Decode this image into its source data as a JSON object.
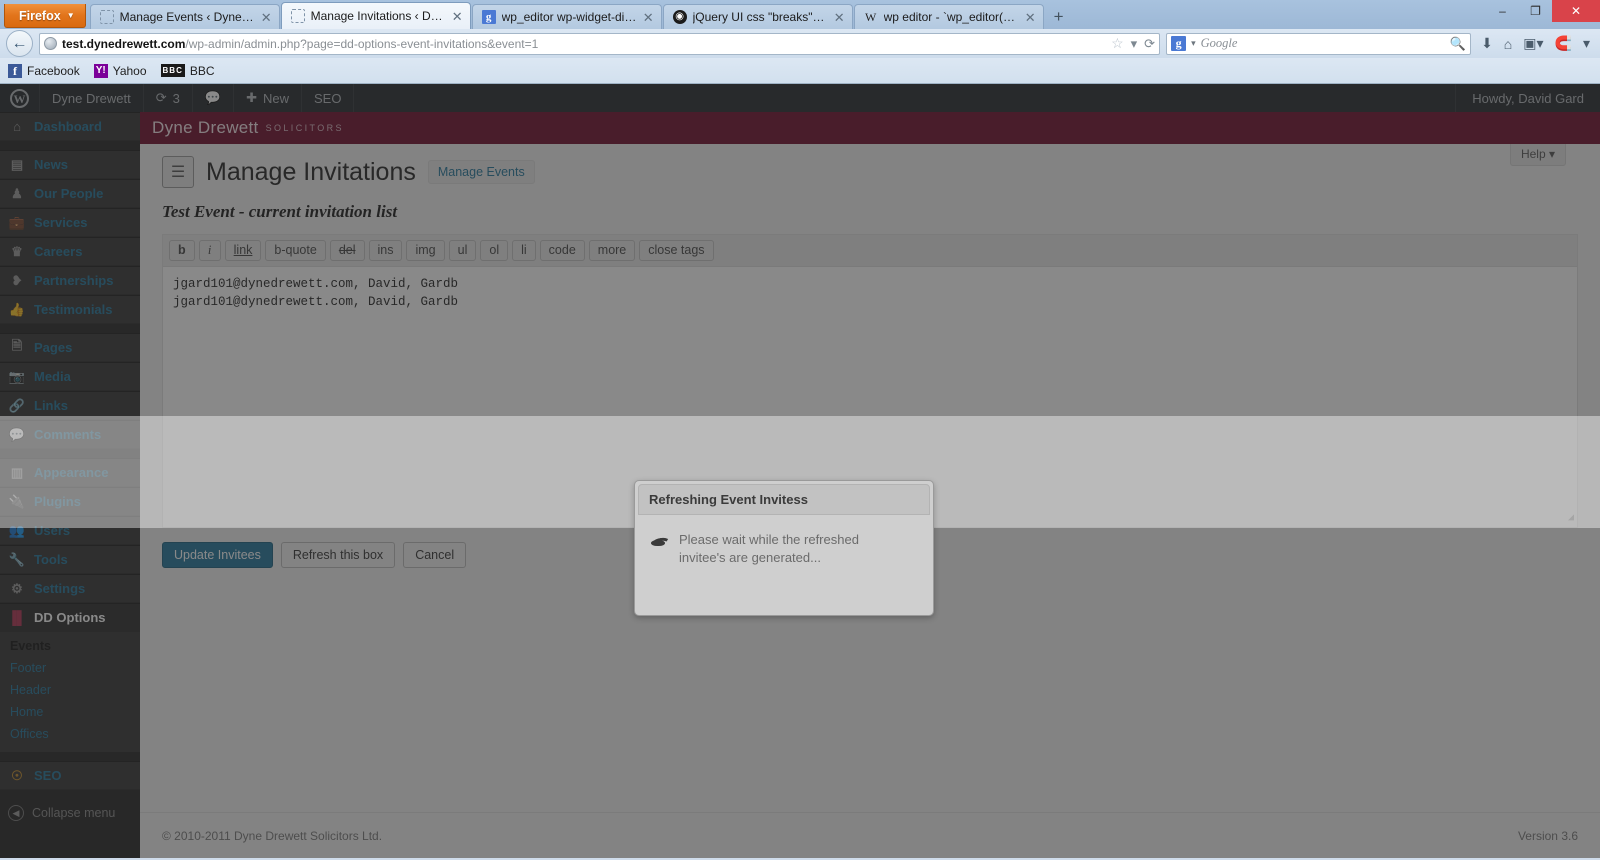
{
  "browser": {
    "app_button": "Firefox",
    "tabs": [
      {
        "title": "Manage Events ‹ Dyne Drewett — Wo...",
        "icon": "blank-favicon",
        "active": false
      },
      {
        "title": "Manage Invitations ‹ Dyne Drewett —...",
        "icon": "blank-favicon",
        "active": true
      },
      {
        "title": "wp_editor wp-widget-dialog - Googl...",
        "icon": "google-favicon",
        "active": false
      },
      {
        "title": "jQuery UI css \"breaks\" WP Editor · Iss...",
        "icon": "github-favicon",
        "active": false
      },
      {
        "title": "wp editor - `wp_editor()` CSS messing...",
        "icon": "wordpress-stack-favicon",
        "active": false
      }
    ],
    "new_tab_label": "+",
    "window_controls": {
      "minimize": "–",
      "restore": "❐",
      "close": "✕"
    },
    "url": {
      "host": "test.dynedrewett.com",
      "path": "/wp-admin/admin.php?page=dd-options-event-invitations&event=1",
      "prefix": ""
    },
    "search": {
      "engine": "Google",
      "placeholder": "Google"
    },
    "bookmarks": [
      {
        "label": "Facebook",
        "icon": "facebook-icon"
      },
      {
        "label": "Yahoo",
        "icon": "yahoo-icon"
      },
      {
        "label": "BBC",
        "icon": "bbc-icon"
      }
    ]
  },
  "adminbar": {
    "logo": "wordpress-logo",
    "site_name": "Dyne Drewett",
    "updates_count": "3",
    "comments_icon": "comment-icon",
    "new_label": "New",
    "seo_label": "SEO",
    "howdy": "Howdy, David Gard"
  },
  "sidebar": {
    "items": [
      {
        "label": "Dashboard",
        "icon": "dashboard-icon"
      },
      {
        "label": "News",
        "icon": "news-icon"
      },
      {
        "label": "Our People",
        "icon": "people-icon"
      },
      {
        "label": "Services",
        "icon": "services-icon"
      },
      {
        "label": "Careers",
        "icon": "careers-icon"
      },
      {
        "label": "Partnerships",
        "icon": "partnerships-icon"
      },
      {
        "label": "Testimonials",
        "icon": "testimonials-icon"
      },
      {
        "label": "Pages",
        "icon": "pages-icon"
      },
      {
        "label": "Media",
        "icon": "media-icon"
      },
      {
        "label": "Links",
        "icon": "links-icon"
      },
      {
        "label": "Comments",
        "icon": "comments-icon"
      },
      {
        "label": "Appearance",
        "icon": "appearance-icon"
      },
      {
        "label": "Plugins",
        "icon": "plugins-icon"
      },
      {
        "label": "Users",
        "icon": "users-icon"
      },
      {
        "label": "Tools",
        "icon": "tools-icon"
      },
      {
        "label": "Settings",
        "icon": "settings-icon"
      },
      {
        "label": "DD Options",
        "icon": "dd-options-icon"
      }
    ],
    "submenu": [
      {
        "label": "Events",
        "current": true
      },
      {
        "label": "Footer",
        "current": false
      },
      {
        "label": "Header",
        "current": false
      },
      {
        "label": "Home",
        "current": false
      },
      {
        "label": "Offices",
        "current": false
      }
    ],
    "seo_item": {
      "label": "SEO",
      "icon": "seo-icon"
    },
    "collapse_label": "Collapse menu"
  },
  "brand": {
    "name": "Dyne Drewett",
    "tagline": "SOLICITORS",
    "color": "#6e0b2b"
  },
  "page": {
    "help_tab": "Help",
    "title": "Manage Invitations",
    "title_icon": "options-sliders-icon",
    "secondary_button": "Manage Events",
    "subheading": "Test Event - current invitation list"
  },
  "editor": {
    "quicktags": [
      "b",
      "i",
      "link",
      "b-quote",
      "del",
      "ins",
      "img",
      "ul",
      "ol",
      "li",
      "code",
      "more",
      "close tags"
    ],
    "content_lines": [
      "jgard101@dynedrewett.com, David, Gardb",
      "jgard101@dynedrewett.com, David, Gardb"
    ],
    "resize_handle": "resize-grip-icon"
  },
  "actions": {
    "primary": "Update Invitees",
    "refresh": "Refresh this box",
    "cancel": "Cancel"
  },
  "dialog": {
    "title": "Refreshing Event Invitess",
    "spinner_icon": "loading-spinner-icon",
    "message": "Please wait while the refreshed invitee's are generated..."
  },
  "footer": {
    "copyright": "© 2010-2011 Dyne Drewett Solicitors Ltd.",
    "version": "Version 3.6"
  }
}
